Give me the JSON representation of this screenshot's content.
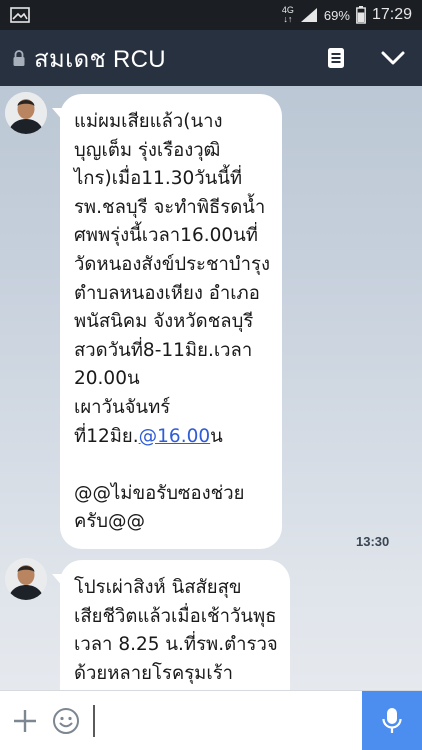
{
  "status_bar": {
    "network_type": "4G",
    "battery": "69%",
    "time": "17:29"
  },
  "header": {
    "title": "สมเดช RCU",
    "colors": {
      "background": "#283140",
      "text": "#ffffff"
    }
  },
  "messages": [
    {
      "lines": [
        "แม่ผมเสียแล้ว(นาง",
        "บุญเต็ม รุ่งเรืองวุฒิ",
        "ไกร)เมื่อ11.30วันนี้ที่",
        "รพ.ชลบุรี จะทำพิธีรดน้ำ",
        "ศพพรุ่งนี้เวลา16.00นที่",
        "วัดหนองสังข์ประชาบำรุง",
        "ตำบลหนองเหียง อำเภอ",
        "พนัสนิคม จังหวัดชลบุรี",
        "สวดวันที่8-11มิย.เวลา",
        "20.00น",
        "เผาวันจันทร์"
      ],
      "link_line": {
        "prefix": "ที่12มิย.",
        "link": "@16.00",
        "suffix": "น"
      },
      "closing_lines": [
        "",
        "@@ไม่ขอรับซองช่วย",
        "ครับ@@"
      ],
      "time": "13:30"
    },
    {
      "lines": [
        "โปรเผ่าสิงห์ นิสสัยสุข",
        "เสียชีวิตแล้วเมื่อเช้าวันพุธ",
        "เวลา 8.25 น.ที่รพ.ตำรวจ",
        "ด้วยหลายโรครุมเร้า"
      ]
    }
  ],
  "input": {
    "placeholder": ""
  },
  "colors": {
    "accent": "#4c8df0",
    "link": "#2f5dd8",
    "bubble": "#ffffff"
  },
  "icons": [
    "gallery-icon",
    "signal-icon",
    "battery-icon",
    "lock-icon",
    "notes-icon",
    "chevron-down-icon",
    "plus-icon",
    "emoji-icon",
    "microphone-icon"
  ]
}
